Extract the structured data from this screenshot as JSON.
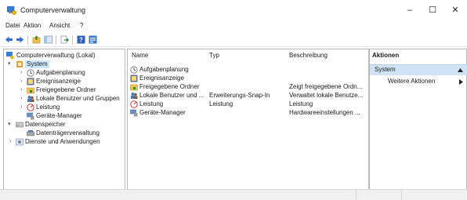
{
  "window": {
    "title": "Computerverwaltung",
    "minimize": "–",
    "maximize": "☐",
    "close": "✕"
  },
  "menu": [
    "Datei",
    "Aktion",
    "Ansicht",
    "?"
  ],
  "toolbar": {
    "icons": [
      "back-arrow-icon",
      "forward-arrow-icon",
      "up-folder-icon",
      "show-hide-tree-icon",
      "export-icon",
      "help-icon",
      "properties-icon"
    ]
  },
  "tree": {
    "root": "Computerverwaltung (Lokal)",
    "system": "System",
    "items": [
      "Aufgabenplanung",
      "Ereignisanzeige",
      "Freigegebene Ordner",
      "Lokale Benutzer und Gruppen",
      "Leistung",
      "Geräte-Manager"
    ],
    "storage": "Datenspeicher",
    "disk": "Datenträgerverwaltung",
    "services": "Dienste und Anwendungen"
  },
  "list": {
    "columns": [
      "Name",
      "Typ",
      "Beschreibung"
    ],
    "rows": [
      {
        "name": "Aufgabenplanung",
        "type": "",
        "desc": ""
      },
      {
        "name": "Ereignisanzeige",
        "type": "",
        "desc": ""
      },
      {
        "name": "Freigegebene Ordner",
        "type": "",
        "desc": "Zeigt freigegebene Ordn..."
      },
      {
        "name": "Lokale Benutzer und ...",
        "type": "Erweiterungs-Snap-In",
        "desc": "Verwaltet lokale Benutze..."
      },
      {
        "name": "Leistung",
        "type": "Leistung",
        "desc": "Leistung"
      },
      {
        "name": "Geräte-Manager",
        "type": "",
        "desc": "Hardwareeinstellungen ..."
      }
    ]
  },
  "actions": {
    "header": "Aktionen",
    "section": "System",
    "more": "Weitere Aktionen"
  }
}
